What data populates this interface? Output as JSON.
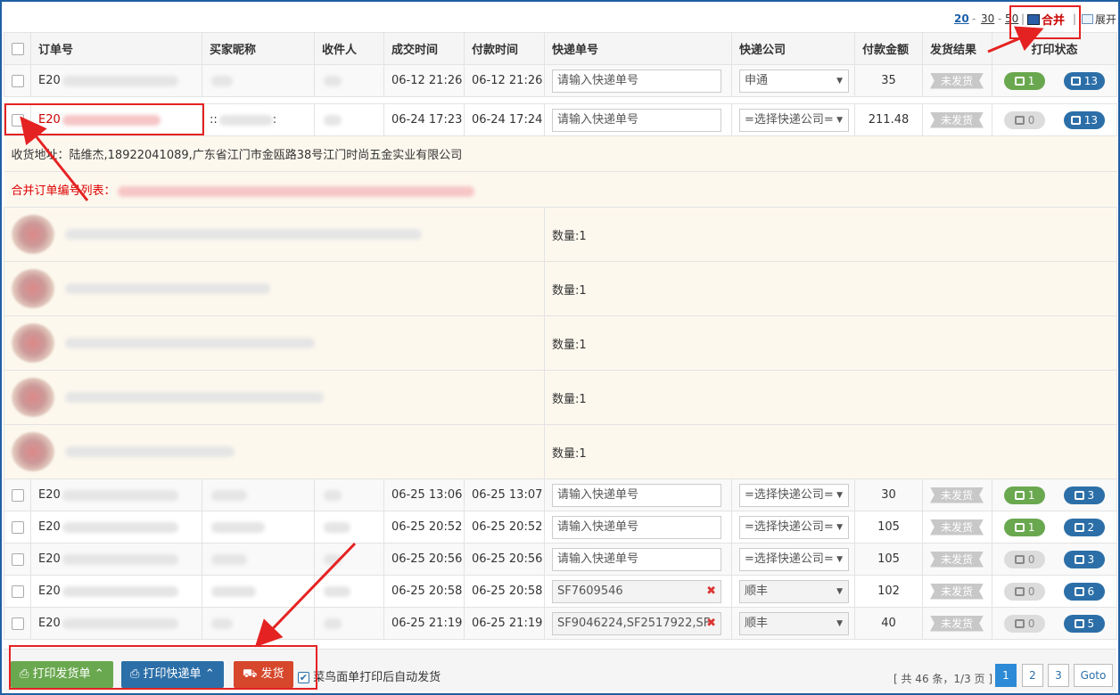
{
  "toolbar": {
    "page_sizes": [
      "20",
      "30",
      "50"
    ],
    "merge_label": "合并",
    "expand_label": "展开"
  },
  "table": {
    "headers": [
      "订单号",
      "买家昵称",
      "收件人",
      "成交时间",
      "付款时间",
      "快递单号",
      "快递公司",
      "付款金额",
      "发货结果",
      "打印状态"
    ],
    "tracking_placeholder": "请输入快递单号",
    "courier_placeholder": "=选择快递公司=",
    "order_prefix": "E20",
    "rows": [
      {
        "paid_time": "06-12 21:26",
        "deal_time": "06-12 21:26",
        "tracking": "",
        "courier": "申通",
        "amount": "35",
        "ship": "未发货",
        "print_a": "1",
        "print_b": "13"
      },
      {
        "deal_time": "06-24 17:23",
        "paid_time": "06-24 17:24",
        "tracking": "",
        "courier": "",
        "amount": "211.48",
        "ship": "未发货",
        "print_a": "0",
        "print_b": "13"
      },
      {
        "deal_time": "06-25 13:06",
        "paid_time": "06-25 13:07",
        "tracking": "",
        "courier": "",
        "amount": "30",
        "ship": "未发货",
        "print_a": "1",
        "print_b": "3"
      },
      {
        "deal_time": "06-25 20:52",
        "paid_time": "06-25 20:52",
        "tracking": "",
        "courier": "",
        "amount": "105",
        "ship": "未发货",
        "print_a": "1",
        "print_b": "2"
      },
      {
        "deal_time": "06-25 20:56",
        "paid_time": "06-25 20:56",
        "tracking": "",
        "courier": "",
        "amount": "105",
        "ship": "未发货",
        "print_a": "0",
        "print_b": "3"
      },
      {
        "deal_time": "06-25 20:58",
        "paid_time": "06-25 20:58",
        "tracking": "SF7609546",
        "courier": "顺丰",
        "amount": "102",
        "ship": "未发货",
        "print_a": "0",
        "print_b": "6"
      },
      {
        "deal_time": "06-25 21:19",
        "paid_time": "06-25 21:19",
        "tracking": "SF9046224,SF2517922,SF",
        "courier": "顺丰",
        "amount": "40",
        "ship": "未发货",
        "print_a": "0",
        "print_b": "5"
      }
    ],
    "expanded": {
      "address_label": "收货地址：",
      "address": "陆维杰,18922041089,广东省江门市金瓯路38号江门时尚五金实业有限公司",
      "merge_list_label": "合并订单编号列表：",
      "qty_text": "数量:1"
    }
  },
  "footer": {
    "print_invoice": "打印发货单",
    "print_express": "打印快递单",
    "ship": "发货",
    "auto_ship": "菜鸟面单打印后自动发货",
    "page_info": "[ 共 46 条，1/3 页 ]",
    "pages": [
      "1",
      "2",
      "3"
    ],
    "goto": "Goto"
  }
}
